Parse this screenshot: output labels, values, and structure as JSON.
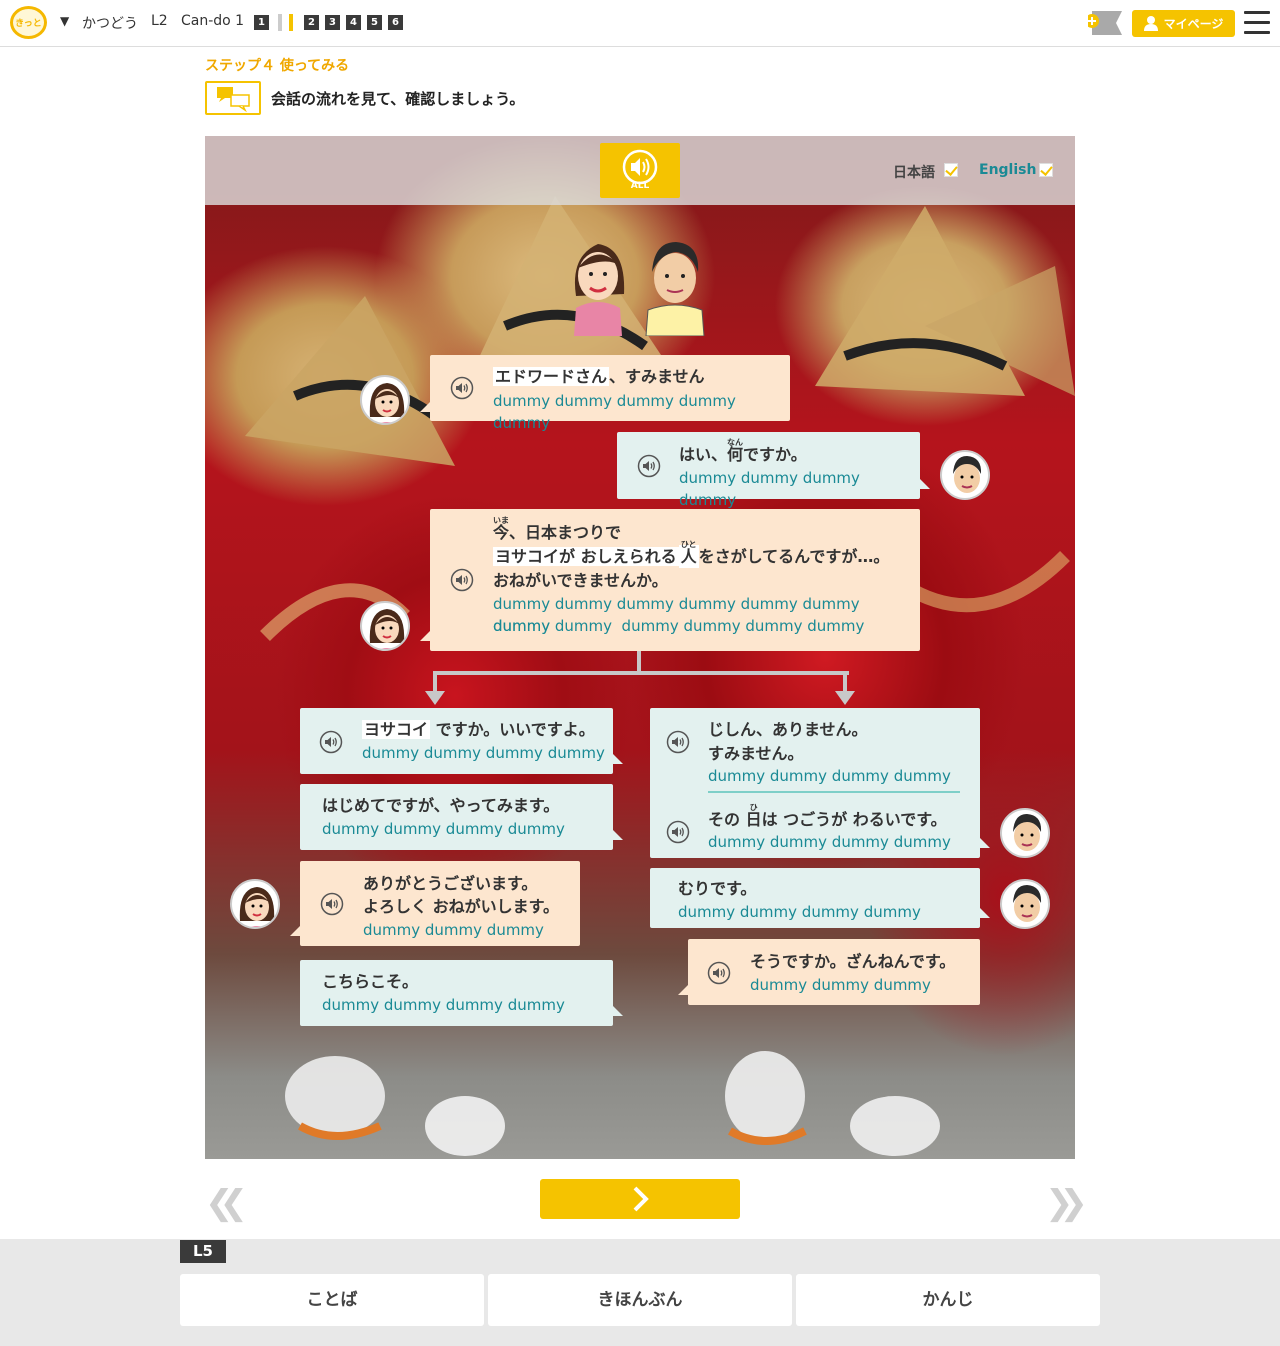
{
  "header": {
    "logo_text": "きっと",
    "category": "かつどう",
    "level": "L2",
    "cando": "Can-do 1",
    "steps": [
      "1",
      "2",
      "3",
      "4",
      "5",
      "6"
    ],
    "mypage_label": "マイページ"
  },
  "step": {
    "title": "ステップ４ 使ってみる",
    "instruction": "会話の流れを見て、確認しましょう。"
  },
  "stage": {
    "all_label": "ALL",
    "lang_japanese": "日本語",
    "lang_english": "English",
    "japanese_checked": true,
    "english_checked": true
  },
  "dialogue": {
    "d1": {
      "ja_highlight": "エドワードさん",
      "ja_rest": "、すみません",
      "en": "dummy dummy dummy dummy dummy"
    },
    "d2": {
      "ja_pre": "はい、",
      "ja_ruby_base": "何",
      "ja_ruby_text": "なん",
      "ja_post": "ですか。",
      "en": "dummy dummy dummy dummy"
    },
    "d3": {
      "line1_ruby_base": "今",
      "line1_ruby_text": "いま",
      "line1_rest": "、日本まつりで",
      "line2_highlight": "ヨサコイが おしえられる",
      "line2_ruby_base": "人",
      "line2_ruby_text": "ひと",
      "line2_rest": "をさがしてるんですが…。",
      "line3": "おねがいできませんか。",
      "en1": "dummy dummy dummy dummy dummy dummy dummy",
      "en2": "dummy dummy  dummy dummy dummy dummy"
    },
    "left1": {
      "ja_highlight": "ヨサコイ",
      "ja_rest": "ですか。いいですよ。",
      "en": "dummy dummy dummy dummy"
    },
    "left2": {
      "ja": "はじめてですが、やってみます。",
      "en": "dummy dummy dummy dummy"
    },
    "left3": {
      "ja1": "ありがとうございます。",
      "ja2": "よろしく おねがいします。",
      "en": "dummy dummy dummy"
    },
    "left4": {
      "ja": "こちらこそ。",
      "en": "dummy dummy dummy dummy"
    },
    "right1": {
      "ja1": "じしん、ありません。",
      "ja2": "すみません。",
      "en1": "dummy dummy dummy dummy",
      "ja3_pre": "その ",
      "ja3_ruby_base": "日",
      "ja3_ruby_text": "ひ",
      "ja3_post": "は つごうが わるいです。",
      "en2": "dummy dummy dummy dummy"
    },
    "right2": {
      "ja": "むりです。",
      "en": "dummy dummy dummy dummy"
    },
    "right3": {
      "ja": "そうですか。ざんねんです。",
      "en": "dummy dummy dummy"
    }
  },
  "footer": {
    "level_badge": "L5",
    "buttons": [
      "ことば",
      "きほんぶん",
      "かんじ"
    ]
  },
  "colors": {
    "accent": "#f5c300",
    "peach_bubble": "#fde6cf",
    "mint_bubble": "#e3f1ef",
    "english_text": "#1a8a95"
  }
}
